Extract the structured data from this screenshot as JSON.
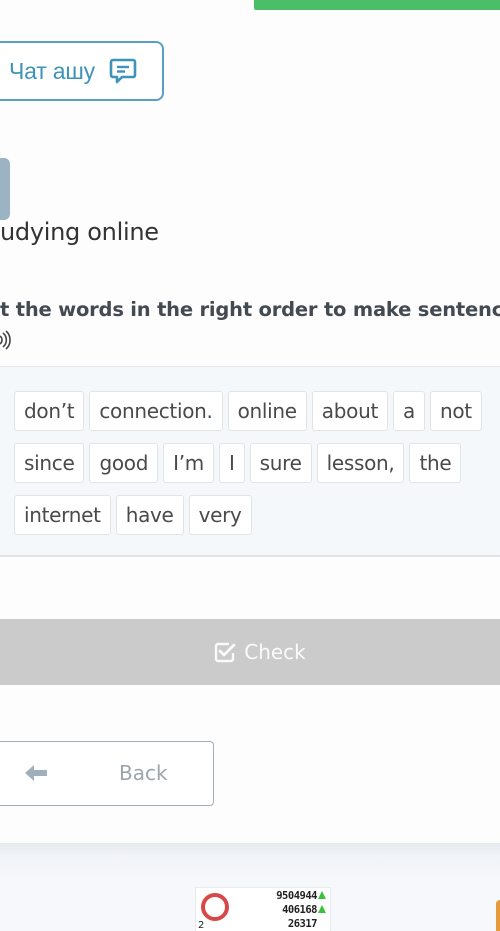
{
  "chat_button": {
    "label": "Чат ашу",
    "icon": "chat-bubble-icon"
  },
  "topic": {
    "title": "udying online"
  },
  "exercise": {
    "instruction": "t the words in the right order to make sentenc",
    "audio_icon": "audio-speaker-icon",
    "word_rows": [
      [
        "don’t",
        "connection.",
        "online",
        "about",
        "a",
        "not"
      ],
      [
        "since",
        "good",
        "I’m",
        "I",
        "sure",
        "lesson,",
        "the"
      ],
      [
        "internet",
        "have",
        "very"
      ]
    ]
  },
  "check_button": {
    "label": "Check",
    "icon": "checkbox-check-icon"
  },
  "back_button": {
    "label": "Back",
    "icon": "arrow-left-icon"
  },
  "counter_widget": {
    "line1": "9504944",
    "line2": "406168",
    "line3": "26317",
    "small_label": "2",
    "colors": {
      "ring": "#d94848",
      "up_arrow": "#3cc13c"
    }
  },
  "colors": {
    "accent_green": "#4cbe68",
    "chat_blue": "#3f93b8",
    "check_disabled": "#cbcbcb"
  }
}
